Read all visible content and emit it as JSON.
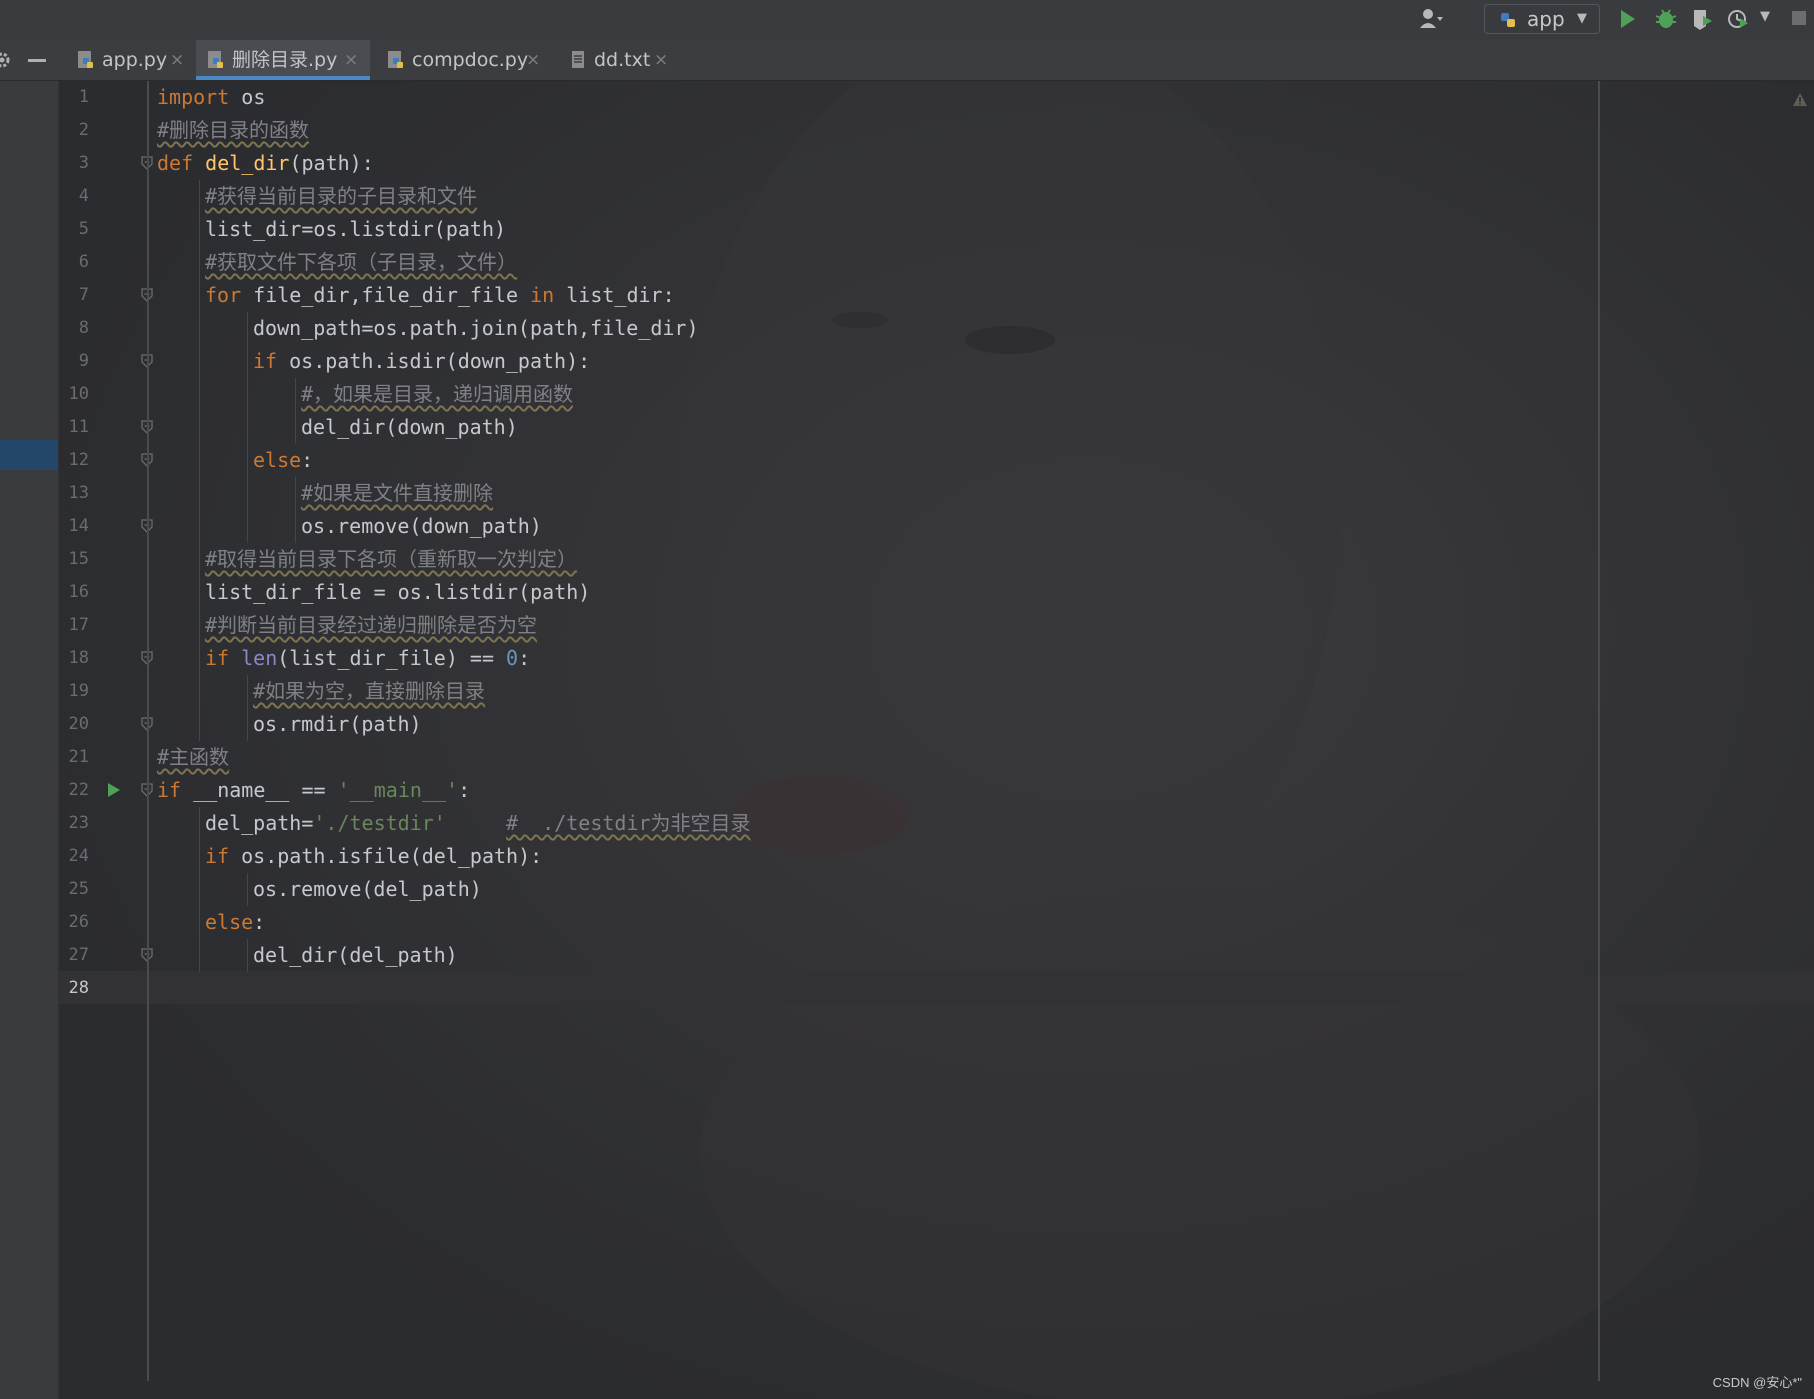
{
  "toolbar": {
    "run_config_label": "app",
    "icons": [
      "user-icon",
      "python-icon",
      "run-icon",
      "debug-icon",
      "coverage-icon",
      "profile-icon",
      "stop-icon"
    ]
  },
  "tabs": [
    {
      "label": "app.py",
      "icon": "python-file-icon",
      "active": false
    },
    {
      "label": "删除目录.py",
      "icon": "python-file-icon",
      "active": true
    },
    {
      "label": "compdoc.py",
      "icon": "python-file-icon",
      "active": false
    },
    {
      "label": "dd.txt",
      "icon": "text-file-icon",
      "active": false
    }
  ],
  "tab_close_glyph": "×",
  "editor": {
    "current_line": 28,
    "line_numbers": [
      "1",
      "2",
      "3",
      "4",
      "5",
      "6",
      "7",
      "8",
      "9",
      "10",
      "11",
      "12",
      "13",
      "14",
      "15",
      "16",
      "17",
      "18",
      "19",
      "20",
      "21",
      "22",
      "23",
      "24",
      "25",
      "26",
      "27",
      "28"
    ],
    "lines": [
      {
        "n": 1,
        "indent": 0,
        "tokens": [
          {
            "t": "import",
            "c": "kw"
          },
          {
            "t": " os",
            "c": ""
          }
        ]
      },
      {
        "n": 2,
        "indent": 0,
        "tokens": [
          {
            "t": "#删除目录的函数",
            "c": "cm"
          }
        ]
      },
      {
        "n": 3,
        "indent": 0,
        "tokens": [
          {
            "t": "def",
            "c": "kw"
          },
          {
            "t": " ",
            "c": ""
          },
          {
            "t": "del_dir",
            "c": "fn"
          },
          {
            "t": "(path):",
            "c": ""
          }
        ]
      },
      {
        "n": 4,
        "indent": 1,
        "tokens": [
          {
            "t": "#获得当前目录的子目录和文件",
            "c": "cm"
          }
        ]
      },
      {
        "n": 5,
        "indent": 1,
        "tokens": [
          {
            "t": "list_dir=os.listdir(path)",
            "c": ""
          }
        ]
      },
      {
        "n": 6,
        "indent": 1,
        "tokens": [
          {
            "t": "#获取文件下各项（子目录，文件）",
            "c": "cm"
          }
        ]
      },
      {
        "n": 7,
        "indent": 1,
        "tokens": [
          {
            "t": "for",
            "c": "kw"
          },
          {
            "t": " file_dir,file_dir_file ",
            "c": ""
          },
          {
            "t": "in",
            "c": "kw"
          },
          {
            "t": " list_dir:",
            "c": ""
          }
        ]
      },
      {
        "n": 8,
        "indent": 2,
        "tokens": [
          {
            "t": "down_path=os.path.join(path,file_dir)",
            "c": ""
          }
        ]
      },
      {
        "n": 9,
        "indent": 2,
        "tokens": [
          {
            "t": "if",
            "c": "kw"
          },
          {
            "t": " os.path.isdir(down_path):",
            "c": ""
          }
        ]
      },
      {
        "n": 10,
        "indent": 3,
        "tokens": [
          {
            "t": "#，如果是目录，递归调用函数",
            "c": "cm"
          }
        ]
      },
      {
        "n": 11,
        "indent": 3,
        "tokens": [
          {
            "t": "del_dir(down_path)",
            "c": ""
          }
        ]
      },
      {
        "n": 12,
        "indent": 2,
        "tokens": [
          {
            "t": "else",
            "c": "kw"
          },
          {
            "t": ":",
            "c": ""
          }
        ]
      },
      {
        "n": 13,
        "indent": 3,
        "tokens": [
          {
            "t": "#如果是文件直接删除",
            "c": "cm"
          }
        ]
      },
      {
        "n": 14,
        "indent": 3,
        "tokens": [
          {
            "t": "os.remove(down_path)",
            "c": ""
          }
        ]
      },
      {
        "n": 15,
        "indent": 1,
        "tokens": [
          {
            "t": "#取得当前目录下各项（重新取一次判定）",
            "c": "cm"
          }
        ]
      },
      {
        "n": 16,
        "indent": 1,
        "tokens": [
          {
            "t": "list_dir_file = os.listdir(path)",
            "c": ""
          }
        ]
      },
      {
        "n": 17,
        "indent": 1,
        "tokens": [
          {
            "t": "#判断当前目录经过递归删除是否为空",
            "c": "cm"
          }
        ]
      },
      {
        "n": 18,
        "indent": 1,
        "tokens": [
          {
            "t": "if",
            "c": "kw"
          },
          {
            "t": " ",
            "c": ""
          },
          {
            "t": "len",
            "c": "bi"
          },
          {
            "t": "(list_dir_file) == ",
            "c": ""
          },
          {
            "t": "0",
            "c": "num"
          },
          {
            "t": ":",
            "c": ""
          }
        ]
      },
      {
        "n": 19,
        "indent": 2,
        "tokens": [
          {
            "t": "#如果为空，直接删除目录",
            "c": "cm"
          }
        ]
      },
      {
        "n": 20,
        "indent": 2,
        "tokens": [
          {
            "t": "os.rmdir(path)",
            "c": ""
          }
        ]
      },
      {
        "n": 21,
        "indent": 0,
        "tokens": [
          {
            "t": "#主函数",
            "c": "cm"
          }
        ]
      },
      {
        "n": 22,
        "indent": 0,
        "tokens": [
          {
            "t": "if",
            "c": "kw"
          },
          {
            "t": " __name__ == ",
            "c": ""
          },
          {
            "t": "'__main__'",
            "c": "st"
          },
          {
            "t": ":",
            "c": ""
          }
        ]
      },
      {
        "n": 23,
        "indent": 1,
        "tokens": [
          {
            "t": "del_path=",
            "c": ""
          },
          {
            "t": "'./testdir'",
            "c": "st"
          },
          {
            "t": "     ",
            "c": ""
          },
          {
            "t": "#  ./testdir为非空目录",
            "c": "cm"
          }
        ]
      },
      {
        "n": 24,
        "indent": 1,
        "tokens": [
          {
            "t": "if",
            "c": "kw"
          },
          {
            "t": " os.path.isfile(del_path):",
            "c": ""
          }
        ]
      },
      {
        "n": 25,
        "indent": 2,
        "tokens": [
          {
            "t": "os.remove(del_path)",
            "c": ""
          }
        ]
      },
      {
        "n": 26,
        "indent": 1,
        "tokens": [
          {
            "t": "else",
            "c": "kw"
          },
          {
            "t": ":",
            "c": ""
          }
        ]
      },
      {
        "n": 27,
        "indent": 2,
        "tokens": [
          {
            "t": "del_dir(del_path)",
            "c": ""
          }
        ]
      },
      {
        "n": 28,
        "indent": 0,
        "tokens": []
      }
    ],
    "fold_markers": [
      3,
      7,
      9,
      11,
      12,
      14,
      18,
      20,
      22,
      27
    ],
    "run_marker_line": 22
  },
  "watermark": "CSDN @安心*\""
}
